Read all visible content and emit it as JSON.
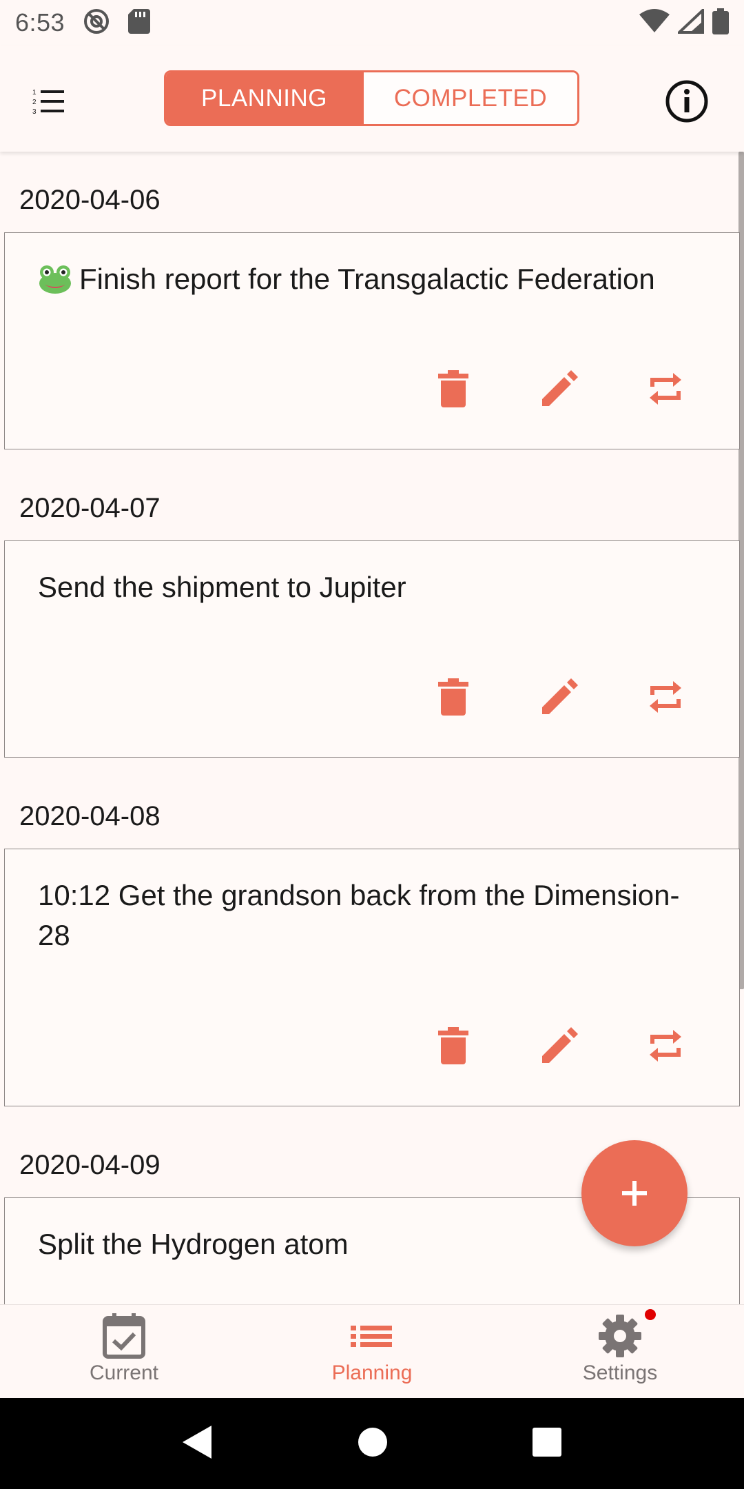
{
  "status_bar": {
    "time": "6:53",
    "icons": [
      "at-sign-icon",
      "sd-card-icon",
      "wifi-icon",
      "signal-icon",
      "battery-icon"
    ]
  },
  "app_bar": {
    "left_icon": "list-numbered-icon",
    "right_icon": "info-icon",
    "tabs": [
      {
        "label": "PLANNING",
        "active": true
      },
      {
        "label": "COMPLETED",
        "active": false
      }
    ]
  },
  "tasks": [
    {
      "date": "2020-04-06",
      "text": "Finish report for the Transgalactic Federation",
      "emoji": "frog"
    },
    {
      "date": "2020-04-07",
      "text": "Send the shipment to Jupiter"
    },
    {
      "date": "2020-04-08",
      "text": "10:12 Get the grandson back from the Dimension-28"
    },
    {
      "date": "2020-04-09",
      "text": "Split the Hydrogen atom"
    }
  ],
  "card_actions": [
    "delete-icon",
    "edit-icon",
    "repeat-icon"
  ],
  "fab": {
    "icon": "plus-icon"
  },
  "bottom_nav": [
    {
      "label": "Current",
      "icon": "calendar-check-icon",
      "active": false
    },
    {
      "label": "Planning",
      "icon": "list-icon",
      "active": true
    },
    {
      "label": "Settings",
      "icon": "gear-icon",
      "active": false,
      "badge": true
    }
  ],
  "colors": {
    "accent": "#eb6d56",
    "background": "#fff8f6",
    "inactive": "#7a7474",
    "badge": "#e00000"
  }
}
